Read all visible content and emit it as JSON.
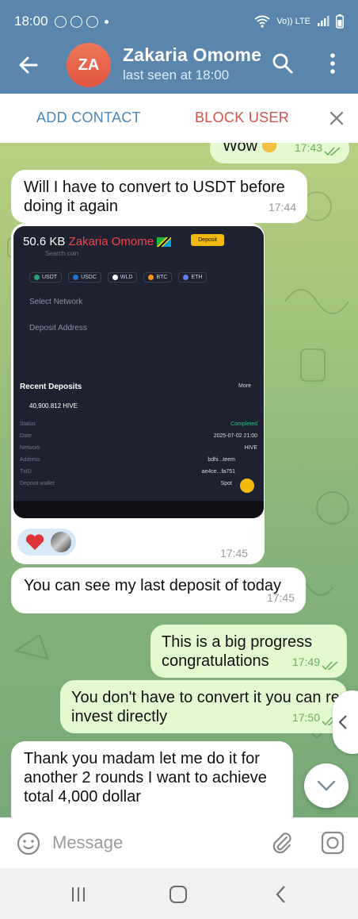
{
  "status_bar": {
    "time": "18:00",
    "network": "Vo)) LTE",
    "icons": [
      "add-circle-icon",
      "add-circle-icon",
      "vpn-icon",
      "wifi-icon",
      "signal-icon",
      "battery-icon"
    ]
  },
  "header": {
    "avatar_initials": "ZA",
    "contact_name": "Zakaria Omome",
    "last_seen": "last seen at 18:00",
    "avatar_color": "#e7614a",
    "bar_color": "#5a86ad"
  },
  "action_bar": {
    "add_contact": "ADD CONTACT",
    "block_user": "BLOCK USER"
  },
  "messages": [
    {
      "dir": "out",
      "text": "Wow",
      "time": "17:43"
    },
    {
      "dir": "in",
      "text": "Will I have to convert to USDT before doing it again",
      "time": "17:44"
    },
    {
      "dir": "in",
      "type": "image",
      "size": "50.6 KB",
      "sender": "Zakaria Omome",
      "reactions": [
        "heart-icon",
        "user-photo-icon"
      ],
      "time": "17:45"
    },
    {
      "dir": "in",
      "text": "You can see my last deposit of today",
      "time": "17:45"
    },
    {
      "dir": "out",
      "text": "This is a big progress congratulations",
      "time": "17:49"
    },
    {
      "dir": "out",
      "text": "You don't have to convert it you can re invest directly",
      "time": "17:50"
    },
    {
      "dir": "in",
      "text": "Thank you madam let me do it for another 2 rounds I want to achieve total 4,000 dollar"
    }
  ],
  "media": {
    "size_label": "50.6 KB",
    "sender": "Zakaria Omome",
    "search_placeholder": "Search coin",
    "deposit_btn": "Deposit",
    "coins": [
      "USDT",
      "USDC",
      "WLD",
      "BTC",
      "ETH"
    ],
    "select_network": "Select Network",
    "deposit_address": "Deposit Address",
    "recent_deposits": "Recent Deposits",
    "more": "More",
    "amount": "40,900.812 HIVE",
    "fields": [
      {
        "label": "Status",
        "value": "Completed"
      },
      {
        "label": "Date",
        "value": "2025-07-02 21:00"
      },
      {
        "label": "Network",
        "value": "HIVE"
      },
      {
        "label": "Address",
        "value": "bdhi...teem"
      },
      {
        "label": "TxID",
        "value": "ae4ce...fa751"
      },
      {
        "label": "Deposit wallet",
        "value": "Spot"
      }
    ]
  },
  "input": {
    "placeholder": "Message"
  },
  "colors": {
    "incoming": "#ffffff",
    "outgoing": "#e3fad1",
    "accent_blue": "#4b86b8",
    "danger": "#d2534b"
  }
}
